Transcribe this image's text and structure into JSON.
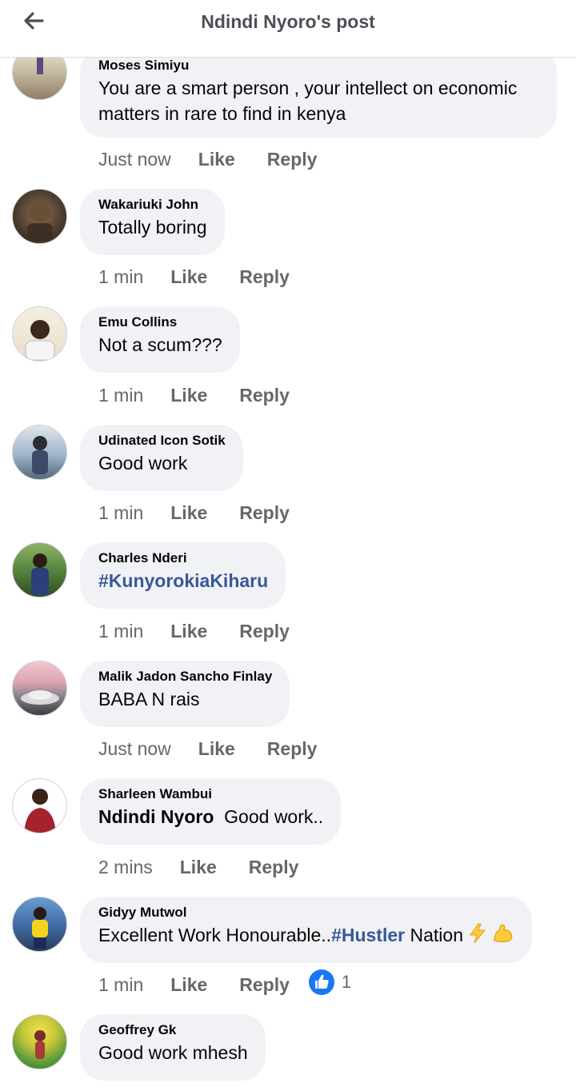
{
  "header": {
    "title": "Ndindi Nyoro's post"
  },
  "actions": {
    "like": "Like",
    "reply": "Reply"
  },
  "comments": [
    {
      "author": "Moses Simiyu",
      "text": "You are a smart person , your intellect on economic matters in rare to find in kenya",
      "time": "Just now"
    },
    {
      "author": "Wakariuki John",
      "text": "Totally  boring",
      "time": "1 min"
    },
    {
      "author": "Emu Collins",
      "text": "Not a scum???",
      "time": "1 min"
    },
    {
      "author": "Udinated Icon Sotik",
      "text": "Good work",
      "time": "1 min"
    },
    {
      "author": "Charles Nderi",
      "hashtag": "#KunyorokiaKiharu",
      "time": "1 min"
    },
    {
      "author": "Malik Jadon Sancho Finlay",
      "text": "BABA N rais",
      "time": "Just now"
    },
    {
      "author": "Sharleen Wambui",
      "mention": "Ndindi Nyoro",
      "text": "Good work..",
      "time": "2 mins"
    },
    {
      "author": "Gidyy Mutwol",
      "text_before": "Excellent Work Honourable..",
      "hashtag": "#Hustler",
      "text_after": " Nation",
      "emojis": [
        "high-voltage-emoji",
        "flexed-biceps-emoji"
      ],
      "time": "1 min",
      "reaction": {
        "icon": "like-reaction-icon",
        "count": "1"
      }
    },
    {
      "author": "Geoffrey Gk",
      "text": "Good work mhesh"
    }
  ],
  "colors": {
    "bubble": "#f0f2f5",
    "meta": "#65676b",
    "hashtag": "#385898",
    "like_blue": "#1877f2"
  }
}
